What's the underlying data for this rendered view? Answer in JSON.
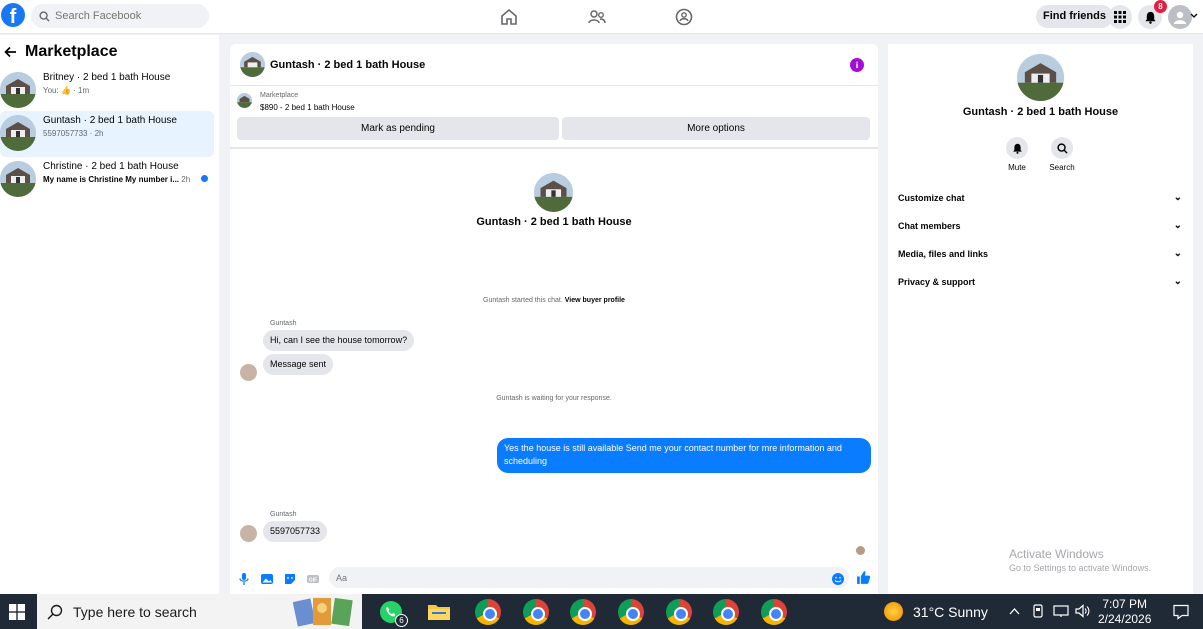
{
  "topbar": {
    "logo": "f",
    "search_placeholder": "Search Facebook",
    "find_friends": "Find friends",
    "notification_count": "8",
    "icons": [
      "home-icon",
      "friends-icon",
      "groups-icon",
      "menu-grid-icon",
      "bell-icon",
      "account-avatar"
    ]
  },
  "sidebar": {
    "title": "Marketplace",
    "conversations": [
      {
        "name": "Britney · 2 bed 1 bath House",
        "preview_prefix": "You:",
        "preview_suffix": "· 1m"
      },
      {
        "name": "Guntash · 2 bed 1 bath House",
        "preview": "5597057733 · 2h"
      },
      {
        "name": "Christine · 2 bed 1 bath House",
        "preview": "My name is Christine My number i...",
        "time": "2h"
      }
    ]
  },
  "chat": {
    "title": "Guntash · 2 bed 1 bath House",
    "marketplace_label": "Marketplace",
    "listing": "$890 - 2 bed 1 bath House",
    "mark_pending": "Mark as pending",
    "more_options": "More options",
    "intro_title": "Guntash · 2 bed 1 bath House",
    "started_text": "Guntash started this chat.",
    "view_buyer": "View buyer profile",
    "sender_1": "Guntash",
    "msg_1": "Hi, can I see the house tomorrow?",
    "msg_2": "Message sent",
    "waiting": "Guntash is waiting for your response.",
    "out_msg": "Yes the house is still available  Send me your contact number for mre information and  scheduling",
    "sender_2": "Guntash",
    "msg_3": "5597057733",
    "input_placeholder": "Aa"
  },
  "details": {
    "title": "Guntash · 2 bed 1 bath House",
    "mute": "Mute",
    "search": "Search",
    "sections": [
      "Customize chat",
      "Chat members",
      "Media, files and links",
      "Privacy & support"
    ]
  },
  "watermark": {
    "line1": "Activate Windows",
    "line2": "Go to Settings to activate Windows."
  },
  "taskbar": {
    "search_text": "Type here to search",
    "whatsapp_badge": "6",
    "weather": "31°C  Sunny",
    "time": "7:07 PM",
    "date": "2/24/2026"
  },
  "colors": {
    "accent": "#1877f2",
    "outgoing_bubble": "#0a7cff",
    "info": "#a20fd6",
    "badge": "#e41e3f"
  }
}
